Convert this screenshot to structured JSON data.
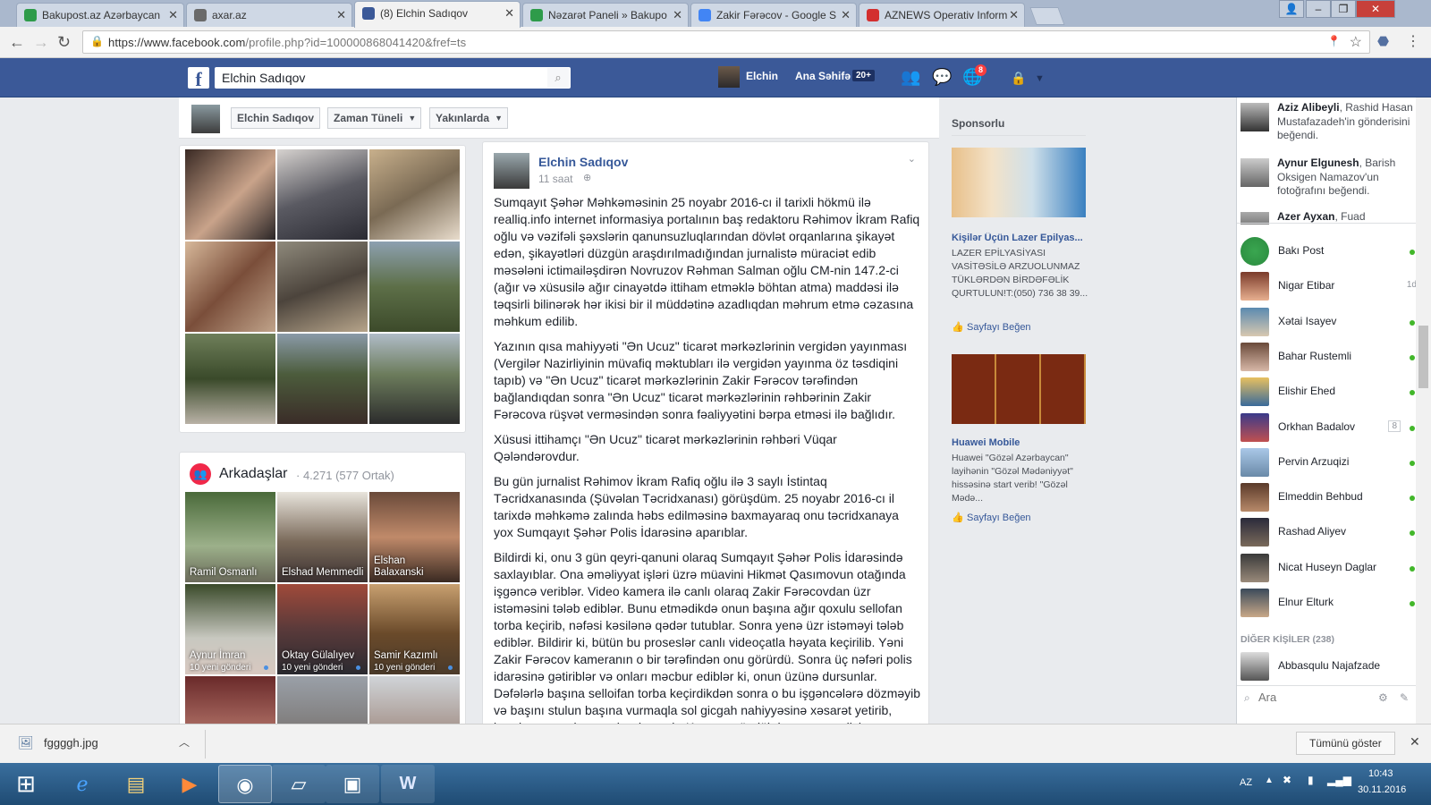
{
  "browser": {
    "tabs": [
      {
        "label": "Bakupost.az Azərbaycan",
        "icon": "bakupost-icon",
        "color": "#2e9b4a"
      },
      {
        "label": "axar.az",
        "icon": "axar-icon",
        "color": "#6a6a6a"
      },
      {
        "label": "(8) Elchin Sadıqov",
        "icon": "facebook-icon",
        "color": "#3b5998"
      },
      {
        "label": "Nəzarət Paneli » Bakupo",
        "icon": "bakupost-icon",
        "color": "#2e9b4a"
      },
      {
        "label": "Zakir Fərəcov - Google S",
        "icon": "google-icon",
        "color": "#4285f4"
      },
      {
        "label": "AZNEWS Operativ Inform",
        "icon": "aznews-icon",
        "color": "#d32f2f"
      }
    ],
    "url_prefix": "https://www.facebook.com",
    "url_path": "/profile.php?id=100000868041420&fref=ts"
  },
  "fb_header": {
    "search_value": "Elchin Sadıqov",
    "user_name": "Elchin",
    "home_label": "Ana Səhifə",
    "home_badge": "20+",
    "notif_badge": "8"
  },
  "timeline_nav": {
    "name_button": "Elchin Sadıqov",
    "timeline_button": "Zaman Tüneli",
    "nearby_button": "Yakınlarda"
  },
  "friends": {
    "title": "Arkadaşlar",
    "count": "· 4.271 (577 Ortak)",
    "items": [
      {
        "name": "Ramil Osmanlı",
        "sub": ""
      },
      {
        "name": "Elshad Memmedli",
        "sub": ""
      },
      {
        "name": "Elshan Balaxanski",
        "sub": ""
      },
      {
        "name": "Aynur İmran",
        "sub": "10 yeni gönderi"
      },
      {
        "name": "Oktay Gülalıyev",
        "sub": "10 yeni gönderi"
      },
      {
        "name": "Samir Kazımlı",
        "sub": "10 yeni gönderi"
      }
    ]
  },
  "post": {
    "author": "Elchin Sadıqov",
    "time": "11 saat",
    "paragraphs": [
      "Sumqayıt Şəhər Məhkəməsinin 25 noyabr 2016-cı il tarixli hökmü ilə realliq.info internet informasiya portalının baş redaktoru Rəhimov İkram Rafiq oğlu və vəzifəli şəxslərin qanunsuzluqlarından dövlət orqanlarına şikayət edən, şikayətləri düzgün araşdırılmadığından jurnalistə müraciət edib məsələni ictimailəşdirən Novruzov Rəhman Salman oğlu CM-nin 147.2-ci (ağır və xüsusilə ağır cinayətdə ittiham etməklə böhtan atma) maddəsi ilə təqsirli bilinərək hər ikisi bir il müddətinə azadlıqdan məhrum etmə cəzasına məhkum edilib.",
      "Yazının qısa mahiyyəti \"Ən Ucuz\" ticarət mərkəzlərinin vergidən yayınması (Vergilər Nazirliyinin müvafiq məktubları ilə vergidən yayınma öz təsdiqini tapıb) və \"Ən Ucuz\" ticarət mərkəzlərinin Zakir Fərəcov tərəfindən bağlandıqdan sonra \"Ən Ucuz\" ticarət mərkəzlərinin rəhbərinin Zakir Fərəcova rüşvət verməsindən sonra fəaliyyətini bərpa etməsi ilə bağlıdır.",
      "Xüsusi ittihamçı \"Ən Ucuz\" ticarət mərkəzlərinin rəhbəri Vüqar Qələndərovdur.",
      "Bu gün jurnalist Rəhimov İkram Rafiq oğlu ilə 3 saylı İstintaq Təcridxanasında (Şüvəlan Təcridxanası) görüşdüm. 25 noyabr 2016-cı il tarixdə məhkəmə zalında həbs edilməsinə baxmayaraq onu təcridxanaya yox Sumqayıt Şəhər Polis İdarəsinə aparıblar.",
      "Bildirdi ki, onu 3 gün qeyri-qanuni olaraq Sumqayıt Şəhər Polis İdarəsində saxlayıblar. Ona əməliyyat işləri üzrə müavini Hikmət Qasımovun otağında işgəncə veriblər. Video kamera ilə canlı olaraq Zakir Fərəcovdan üzr istəməsini tələb ediblər. Bunu etmədikdə onun başına ağır qoxulu sellofan torba keçirib, nəfəsi kəsilənə qədər tutublar. Sonra yenə üzr istəməyi tələb ediblər. Bildirir ki, bütün bu proseslər canlı videoçatla həyata keçirilib. Yəni Zakir Fərəcov kameranın o bir tərəfindən onu görürdü. Sonra üç nəfəri polis idarəsinə gətiriblər və onları məcbur ediblər ki, onun üzünə dursunlar. Dəfələrlə başına selloifan torba keçirdikdən sonra o bu işgəncələrə dözməyib və başını stulun başına vurmaqla sol gicgah nahiyyəsinə xəsarət yetirib, bundan sonra işgəncələr dayanıb. Kamera söndükdən sonra polislər"
    ]
  },
  "sponsored": {
    "title": "Sponsorlu",
    "ads": [
      {
        "headline": "Kişilər Üçün Lazer Epilyas...",
        "body": "LAZER EPİLYASİYASI VASİTƏSİLƏ ARZUOLUNMAZ TÜKLƏRDƏN BİRDƏFƏLİK QURTULUN!T:(050) 736 38 39...",
        "like": "Sayfayı Beğen"
      },
      {
        "headline": "Huawei Mobile",
        "body": "Huawei \"Gözəl Azərbaycan\" layihənin \"Gözəl Mədəniyyət\" hissəsinə start verib! \"Gözəl Mədə...",
        "like": "Sayfayı Beğen"
      }
    ]
  },
  "ticker": [
    {
      "name": "Aziz Alibeyli",
      "rest": ", Rashid Hasan Mustafazadeh'in gönderisini beğendi."
    },
    {
      "name": "Aynur Elgunesh",
      "rest": ", Barish Oksigen Namazov'un fotoğrafını beğendi."
    },
    {
      "name": "Azer Ayxan",
      "rest": ", Fuad"
    }
  ],
  "chat": {
    "contacts": [
      {
        "name": "Bakı Post",
        "status": "online"
      },
      {
        "name": "Nigar Etibar",
        "status": "1d"
      },
      {
        "name": "Xətai Isayev",
        "status": "online"
      },
      {
        "name": "Bahar Rustemli",
        "status": "online"
      },
      {
        "name": "Elishir Ehed",
        "status": "online"
      },
      {
        "name": "Orkhan Badalov",
        "status": "8"
      },
      {
        "name": "Pervin Arzuqizi",
        "status": "online"
      },
      {
        "name": "Elmeddin Behbud",
        "status": "online"
      },
      {
        "name": "Rashad Aliyev",
        "status": "online"
      },
      {
        "name": "Nicat Huseyn Daglar",
        "status": "online"
      },
      {
        "name": "Elnur Elturk",
        "status": "online"
      }
    ],
    "other_header": "DİĞER KİŞİLER (238)",
    "other_contact": "Abbasqulu Najafzade",
    "search_placeholder": "Ara"
  },
  "download_bar": {
    "file": "fggggh.jpg",
    "show_all": "Tümünü göster"
  },
  "taskbar": {
    "lang": "AZ",
    "time": "10:43",
    "date": "30.11.2016"
  }
}
